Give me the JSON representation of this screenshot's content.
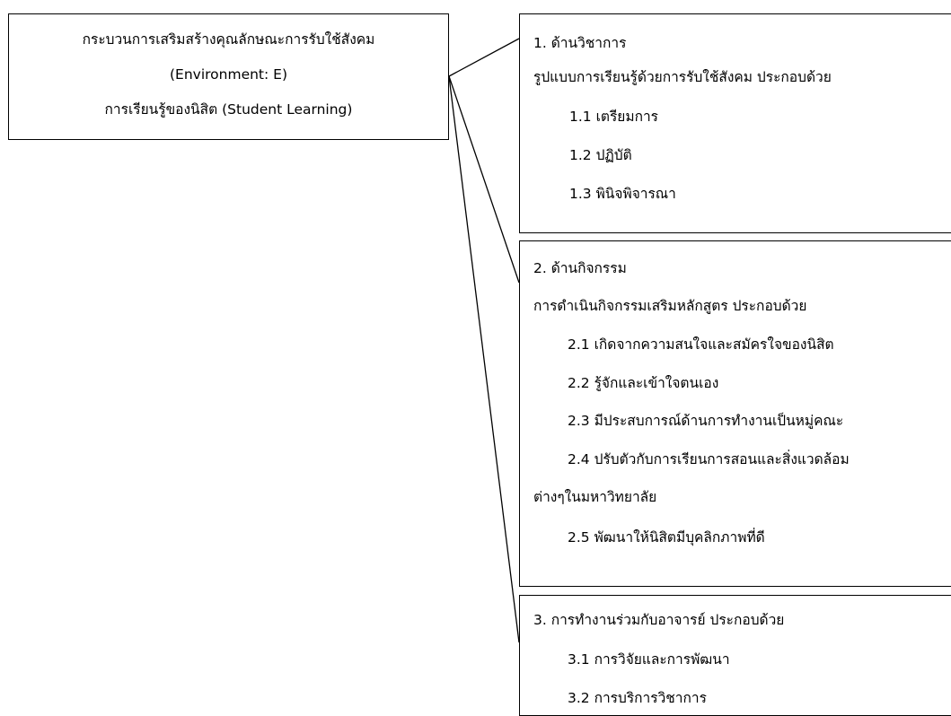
{
  "root": {
    "line1": "กระบวนการเสริมสร้างคุณลักษณะการรับใช้สังคม",
    "line2": "(Environment: E)",
    "line3": "การเรียนรู้ของนิสิต (Student Learning)"
  },
  "branches": [
    {
      "title": "1. ด้านวิชาการ",
      "subtitle": "รูปแบบการเรียนรู้ด้วยการรับใช้สังคม ประกอบด้วย",
      "items": [
        "1.1 เตรียมการ",
        "1.2 ปฏิบัติ",
        "1.3 พินิจพิจารณา"
      ]
    },
    {
      "title": "2. ด้านกิจกรรม",
      "subtitle": "การดำเนินกิจกรรมเสริมหลักสูตร ประกอบด้วย",
      "items": [
        "2.1 เกิดจากความสนใจและสมัครใจของนิสิต",
        "2.2 รู้จักและเข้าใจตนเอง",
        "2.3 มีประสบการณ์ด้านการทำงานเป็นหมู่คณะ",
        "2.4 ปรับตัวกับการเรียนการสอนและสิ่งแวดล้อม",
        "ต่างๆในมหาวิทยาลัย",
        "2.5 พัฒนาให้นิสิตมีบุคลิกภาพที่ดี"
      ]
    },
    {
      "title": "3. การทำงานร่วมกับอาจารย์ ประกอบด้วย",
      "items": [
        "3.1 การวิจัยและการพัฒนา",
        "3.2 การบริการวิชาการ"
      ]
    }
  ]
}
